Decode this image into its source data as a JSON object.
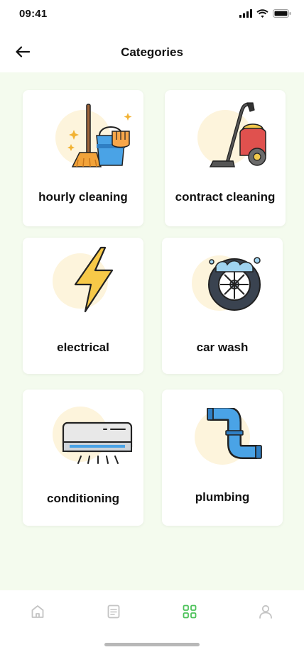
{
  "status_bar": {
    "time": "09:41"
  },
  "header": {
    "title": "Categories"
  },
  "categories": [
    {
      "label": "hourly cleaning"
    },
    {
      "label": "contract cleaning"
    },
    {
      "label": "electrical"
    },
    {
      "label": "car wash"
    },
    {
      "label": "conditioning"
    },
    {
      "label": "plumbing"
    }
  ],
  "colors": {
    "accent": "#4cc25a",
    "blob": "#fdf4dc",
    "background": "#f4fbee",
    "nav_inactive": "#c4c4c4"
  },
  "bottom_nav": [
    {
      "icon": "home-icon",
      "active": false
    },
    {
      "icon": "document-icon",
      "active": false
    },
    {
      "icon": "grid-icon",
      "active": true
    },
    {
      "icon": "profile-icon",
      "active": false
    }
  ]
}
